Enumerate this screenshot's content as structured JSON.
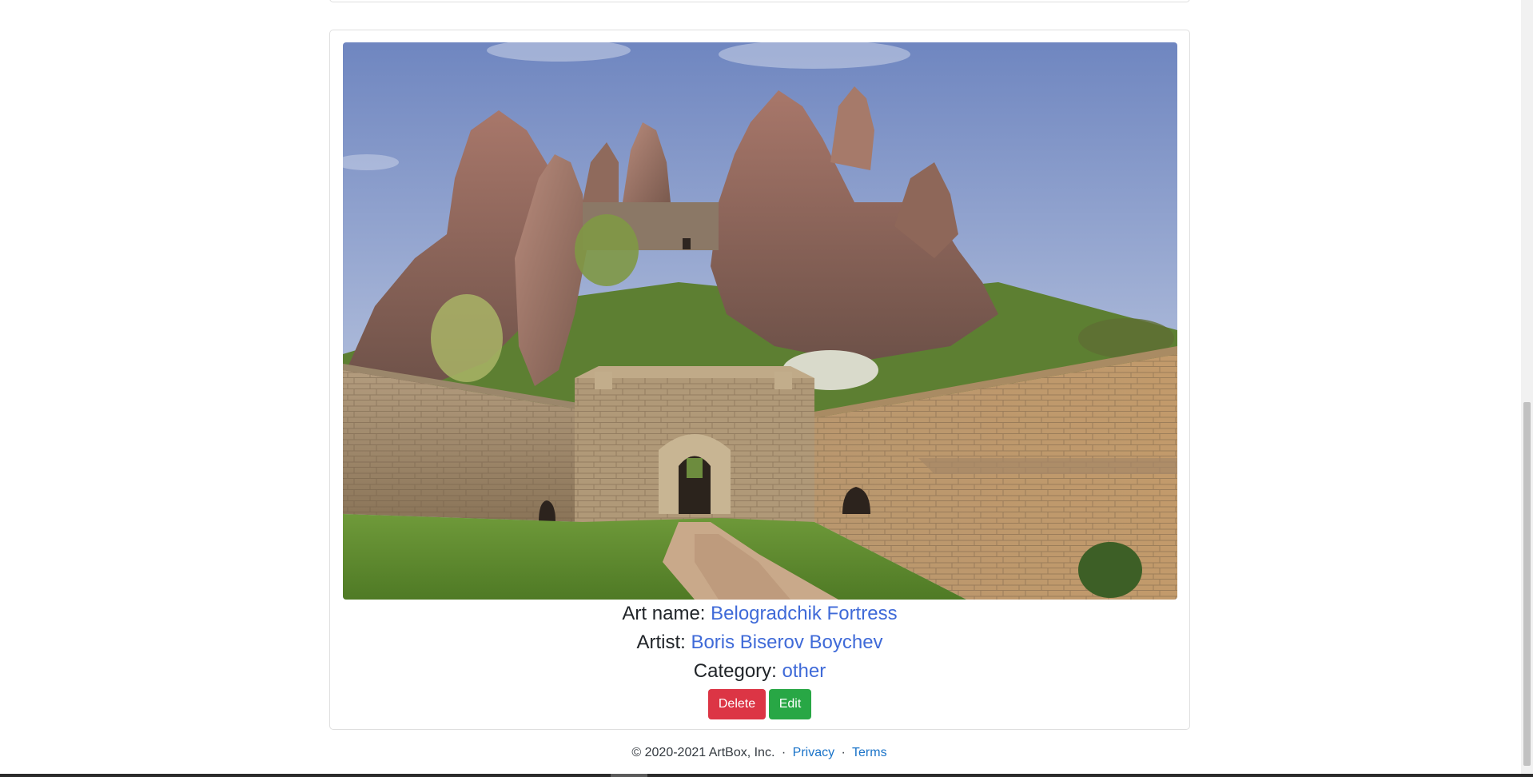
{
  "artwork": {
    "image_alt": "Belogradchik Fortress",
    "name_label": "Art name:",
    "name": "Belogradchik Fortress",
    "artist_label": "Artist:",
    "artist": "Boris Biserov Boychev",
    "category_label": "Category:",
    "category": "other"
  },
  "actions": {
    "delete_label": "Delete",
    "edit_label": "Edit"
  },
  "footer": {
    "copyright": "© 2020-2021 ArtBox, Inc.",
    "separator": "·",
    "privacy_label": "Privacy",
    "terms_label": "Terms"
  },
  "colors": {
    "link": "#3f6ad8",
    "delete": "#dc3545",
    "edit": "#28a745"
  }
}
